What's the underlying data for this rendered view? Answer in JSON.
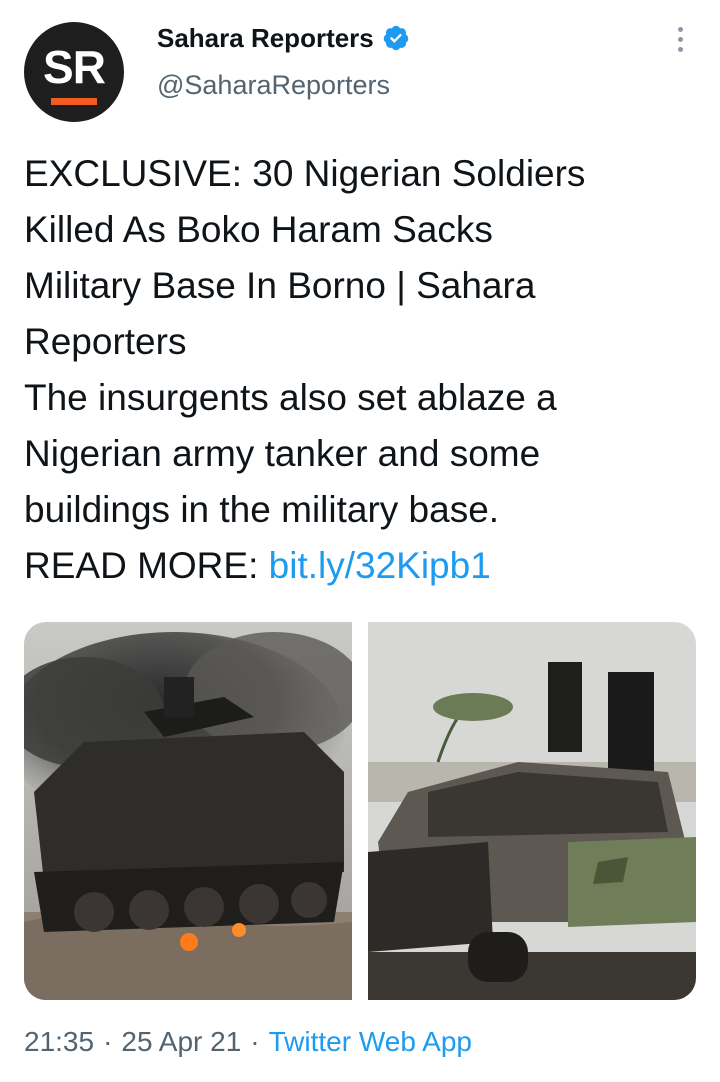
{
  "account": {
    "logo_text": "SR",
    "name": "Sahara Reporters",
    "handle": "@SaharaReporters",
    "verified_icon": "verified-badge-icon",
    "brand_color": "#f25c23"
  },
  "tweet": {
    "text": "EXCLUSIVE: 30 Nigerian Soldiers\nKilled As Boko Haram Sacks\nMilitary Base In Borno | Sahara\nReporters\nThe insurgents also set ablaze a\nNigerian army tanker and some\nbuildings in the military base.\nREAD MORE: ",
    "link": "bit.ly/32Kipb1",
    "link_color": "#1d9bf0"
  },
  "meta": {
    "time": "21:35",
    "separator": "·",
    "date": "25 Apr 21",
    "source": "Twitter Web App"
  },
  "icons": {
    "more": "more-options-icon"
  }
}
